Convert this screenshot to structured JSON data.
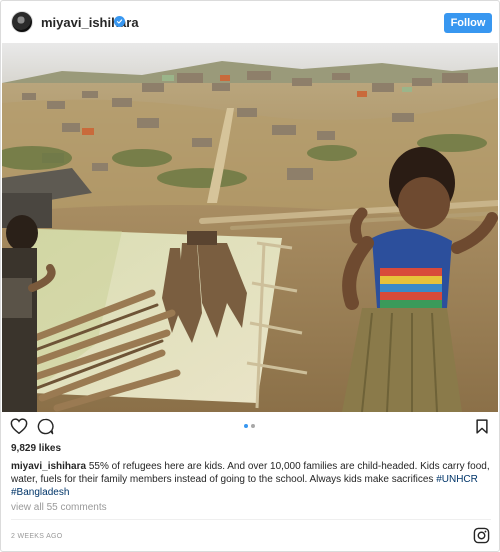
{
  "post": {
    "username": "miyavi_ishihara",
    "follow_label": "Follow",
    "likes": "9,829 likes",
    "caption": {
      "user": "miyavi_ishihara",
      "text": "55% of refugees here are kids. And over 10,000 families are child-headed. Kids carry food, water, fuels for their family members instead of going to the school. Always kids make sacrifices",
      "tags": [
        "#UNHCR",
        "#Bangladesh"
      ]
    },
    "view_comments": "view all 55 comments",
    "timestamp": "2 WEEKS AGO",
    "carousel": {
      "count": 2,
      "active_index": 0
    }
  },
  "icons": {
    "verified": "verified-badge-icon",
    "like": "heart-icon",
    "comment": "comment-bubble-icon",
    "save": "bookmark-icon",
    "brand": "instagram-icon"
  },
  "colors": {
    "accent": "#3897f0",
    "hashtag": "#003569",
    "muted": "#999999",
    "text": "#262626"
  }
}
